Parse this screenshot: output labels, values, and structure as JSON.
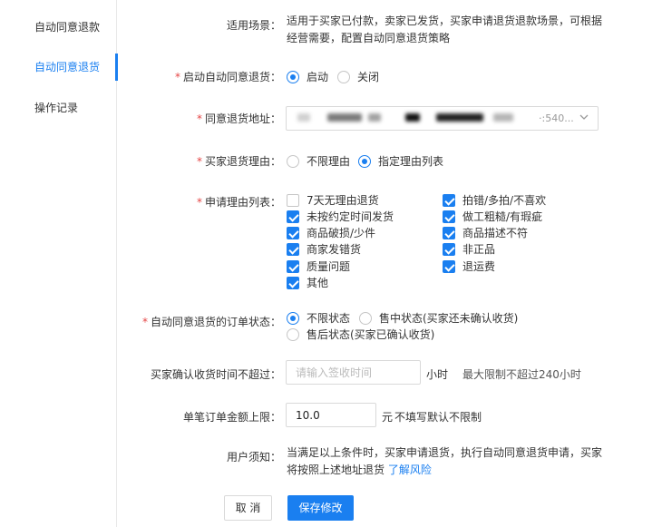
{
  "sidebar": {
    "items": [
      {
        "label": "自动同意退款",
        "active": false
      },
      {
        "label": "自动同意退货",
        "active": true
      },
      {
        "label": "操作记录",
        "active": false
      }
    ]
  },
  "form": {
    "scene": {
      "label": "适用场景：",
      "line1": "适用于买家已付款，卖家已发货，买家申请退货退款场景，可根据",
      "line2": "经营需要，配置自动同意退货策略"
    },
    "enable": {
      "label": "启动自动同意退货：",
      "options": [
        "启动",
        "关闭"
      ],
      "selected": "启动"
    },
    "address": {
      "label": "同意退货地址：",
      "value_tail": "·:540..."
    },
    "reason_mode": {
      "label": "买家退货理由：",
      "options": [
        "不限理由",
        "指定理由列表"
      ],
      "selected": "指定理由列表"
    },
    "reason_list": {
      "label": "申请理由列表：",
      "items": [
        {
          "label": "7天无理由退货",
          "checked": false
        },
        {
          "label": "拍错/多拍/不喜欢",
          "checked": true
        },
        {
          "label": "未按约定时间发货",
          "checked": true
        },
        {
          "label": "做工粗糙/有瑕疵",
          "checked": true
        },
        {
          "label": "商品破损/少件",
          "checked": true
        },
        {
          "label": "商品描述不符",
          "checked": true
        },
        {
          "label": "商家发错货",
          "checked": true
        },
        {
          "label": "非正品",
          "checked": true
        },
        {
          "label": "质量问题",
          "checked": true
        },
        {
          "label": "退运费",
          "checked": true
        },
        {
          "label": "其他",
          "checked": true
        }
      ]
    },
    "order_status": {
      "label": "自动同意退货的订单状态：",
      "options": [
        "不限状态",
        "售中状态(买家还未确认收货)",
        "售后状态(买家已确认收货)"
      ],
      "selected": "不限状态"
    },
    "confirm_time": {
      "label": "买家确认收货时间不超过：",
      "placeholder": "请输入签收时间",
      "unit": "小时",
      "hint": "最大限制不超过240小时"
    },
    "amount_limit": {
      "label": "单笔订单金额上限：",
      "value": "10.0",
      "unit": "元",
      "hint": "不填写默认不限制"
    },
    "notice": {
      "label": "用户须知：",
      "line1": "当满足以上条件时，买家申请退货，执行自动同意退货申请，买家",
      "line2": "将按照上述地址退货",
      "link": "了解风险"
    }
  },
  "actions": {
    "cancel": "取 消",
    "save": "保存修改"
  },
  "colors": {
    "accent": "#1a7ff0",
    "required": "#e54545"
  }
}
